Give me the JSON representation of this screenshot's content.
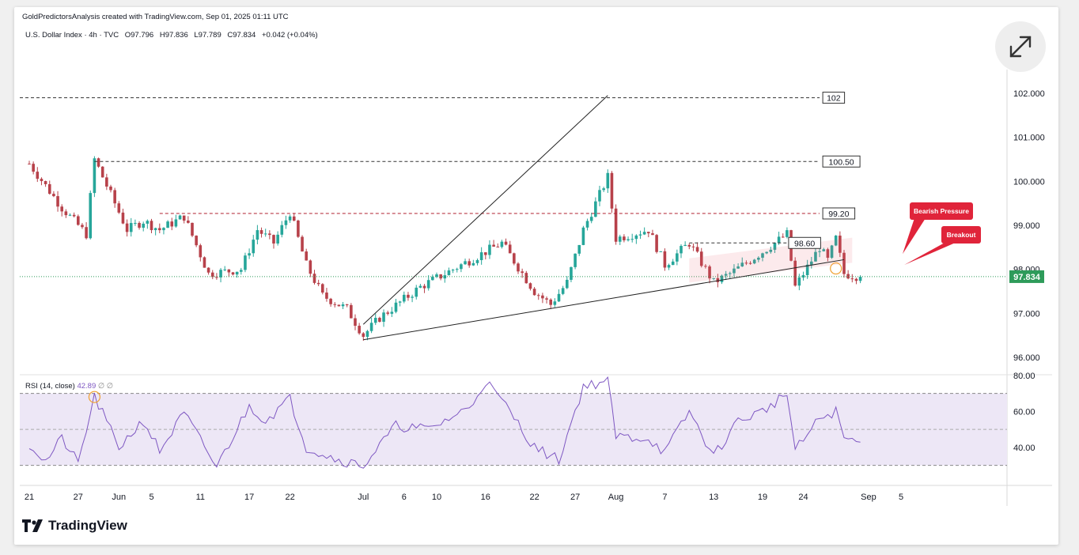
{
  "attribution": "GoldPredictorsAnalysis created with TradingView.com, Sep 01, 2025 01:11 UTC",
  "symbol": {
    "name": "U.S. Dollar Index · 4h · TVC",
    "open": "O97.796",
    "high": "H97.836",
    "low": "L97.789",
    "close": "C97.834",
    "change": "+0.042 (+0.04%)"
  },
  "brand": "TradingView",
  "colors": {
    "up": "#26a69a",
    "down": "#b7414a",
    "rsi_line": "#7e57c2",
    "rsi_band": "#ede7f6",
    "price_tag": "#2e9b5a",
    "callout": "#e0243a"
  },
  "chart_data": [
    {
      "type": "candlestick",
      "series_name": "U.S. Dollar Index",
      "ylim": [
        96.0,
        102.0
      ],
      "y_ticks": [
        "102.000",
        "101.000",
        "100.000",
        "99.000",
        "98.000",
        "97.000",
        "96.000"
      ],
      "x_ticks": [
        "21",
        "27",
        "Jun",
        "5",
        "11",
        "17",
        "22",
        "Jul",
        "6",
        "10",
        "16",
        "22",
        "27",
        "Aug",
        "7",
        "13",
        "19",
        "24",
        "Sep",
        "5"
      ],
      "last_price": "97.834",
      "path_points": [
        {
          "date": "2025-05-21",
          "value": 100.4
        },
        {
          "date": "2025-05-25",
          "value": 99.4
        },
        {
          "date": "2025-05-28",
          "value": 98.8
        },
        {
          "date": "2025-05-29",
          "value": 100.5
        },
        {
          "date": "2025-06-02",
          "value": 98.9
        },
        {
          "date": "2025-06-04",
          "value": 99.1
        },
        {
          "date": "2025-06-06",
          "value": 98.9
        },
        {
          "date": "2025-06-09",
          "value": 99.2
        },
        {
          "date": "2025-06-12",
          "value": 97.9
        },
        {
          "date": "2025-06-16",
          "value": 98.0
        },
        {
          "date": "2025-06-18",
          "value": 98.9
        },
        {
          "date": "2025-06-20",
          "value": 98.6
        },
        {
          "date": "2025-06-22",
          "value": 99.3
        },
        {
          "date": "2025-06-24",
          "value": 98.1
        },
        {
          "date": "2025-06-26",
          "value": 97.4
        },
        {
          "date": "2025-06-29",
          "value": 97.1
        },
        {
          "date": "2025-07-01",
          "value": 96.5
        },
        {
          "date": "2025-07-03",
          "value": 96.9
        },
        {
          "date": "2025-07-08",
          "value": 97.6
        },
        {
          "date": "2025-07-14",
          "value": 98.2
        },
        {
          "date": "2025-07-18",
          "value": 98.6
        },
        {
          "date": "2025-07-22",
          "value": 97.5
        },
        {
          "date": "2025-07-24",
          "value": 97.2
        },
        {
          "date": "2025-07-26",
          "value": 97.7
        },
        {
          "date": "2025-07-28",
          "value": 98.9
        },
        {
          "date": "2025-07-31",
          "value": 100.1
        },
        {
          "date": "2025-08-01",
          "value": 98.7
        },
        {
          "date": "2025-08-05",
          "value": 98.9
        },
        {
          "date": "2025-08-07",
          "value": 98.1
        },
        {
          "date": "2025-08-10",
          "value": 98.6
        },
        {
          "date": "2025-08-13",
          "value": 97.7
        },
        {
          "date": "2025-08-15",
          "value": 97.9
        },
        {
          "date": "2025-08-19",
          "value": 98.4
        },
        {
          "date": "2025-08-22",
          "value": 98.8
        },
        {
          "date": "2025-08-23",
          "value": 97.6
        },
        {
          "date": "2025-08-26",
          "value": 98.5
        },
        {
          "date": "2025-08-27",
          "value": 98.2
        },
        {
          "date": "2025-08-28",
          "value": 98.7
        },
        {
          "date": "2025-08-29",
          "value": 97.9
        },
        {
          "date": "2025-08-31",
          "value": 97.83
        }
      ],
      "levels": [
        {
          "label": "102",
          "value": 101.9,
          "color": "#333333"
        },
        {
          "label": "100.50",
          "value": 100.45,
          "color": "#333333"
        },
        {
          "label": "99.20",
          "value": 99.27,
          "color": "#b0202f"
        },
        {
          "label": "98.60",
          "value": 98.6,
          "color": "#333333"
        }
      ],
      "trendlines": [
        {
          "from": {
            "date": "2025-07-01",
            "value": 96.4
          },
          "to": {
            "date": "2025-08-29",
            "value": 98.22
          }
        },
        {
          "from": {
            "date": "2025-07-01",
            "value": 96.75
          },
          "to": {
            "date": "2025-07-31",
            "value": 101.95
          }
        }
      ],
      "annotations": [
        {
          "text": "Bearish Pressure",
          "date": "2025-08-28"
        },
        {
          "text": "Breakout",
          "date": "2025-08-28"
        }
      ]
    },
    {
      "type": "line",
      "series_name": "RSI (14, close)",
      "value_label": "42.89",
      "extra_labels": [
        "∅",
        "∅"
      ],
      "ylim": [
        25,
        80
      ],
      "y_ticks": [
        "80.00",
        "60.00",
        "40.00"
      ],
      "band": [
        30,
        70
      ],
      "midline": 50,
      "path_points": [
        {
          "date": "2025-05-21",
          "value": 42
        },
        {
          "date": "2025-05-23",
          "value": 32
        },
        {
          "date": "2025-05-25",
          "value": 45
        },
        {
          "date": "2025-05-27",
          "value": 31
        },
        {
          "date": "2025-05-29",
          "value": 68
        },
        {
          "date": "2025-06-01",
          "value": 40
        },
        {
          "date": "2025-06-04",
          "value": 55
        },
        {
          "date": "2025-06-06",
          "value": 38
        },
        {
          "date": "2025-06-09",
          "value": 59
        },
        {
          "date": "2025-06-13",
          "value": 29
        },
        {
          "date": "2025-06-17",
          "value": 63
        },
        {
          "date": "2025-06-19",
          "value": 55
        },
        {
          "date": "2025-06-22",
          "value": 67
        },
        {
          "date": "2025-06-24",
          "value": 40
        },
        {
          "date": "2025-06-28",
          "value": 33
        },
        {
          "date": "2025-07-01",
          "value": 30
        },
        {
          "date": "2025-07-05",
          "value": 52
        },
        {
          "date": "2025-07-09",
          "value": 50
        },
        {
          "date": "2025-07-14",
          "value": 62
        },
        {
          "date": "2025-07-16",
          "value": 77
        },
        {
          "date": "2025-07-19",
          "value": 60
        },
        {
          "date": "2025-07-22",
          "value": 40
        },
        {
          "date": "2025-07-25",
          "value": 33
        },
        {
          "date": "2025-07-28",
          "value": 74
        },
        {
          "date": "2025-07-31",
          "value": 77
        },
        {
          "date": "2025-08-01",
          "value": 46
        },
        {
          "date": "2025-08-05",
          "value": 45
        },
        {
          "date": "2025-08-07",
          "value": 37
        },
        {
          "date": "2025-08-10",
          "value": 60
        },
        {
          "date": "2025-08-13",
          "value": 35
        },
        {
          "date": "2025-08-16",
          "value": 55
        },
        {
          "date": "2025-08-19",
          "value": 60
        },
        {
          "date": "2025-08-22",
          "value": 70
        },
        {
          "date": "2025-08-23",
          "value": 38
        },
        {
          "date": "2025-08-26",
          "value": 56
        },
        {
          "date": "2025-08-28",
          "value": 60
        },
        {
          "date": "2025-08-29",
          "value": 45
        },
        {
          "date": "2025-08-31",
          "value": 42.89
        }
      ]
    }
  ]
}
